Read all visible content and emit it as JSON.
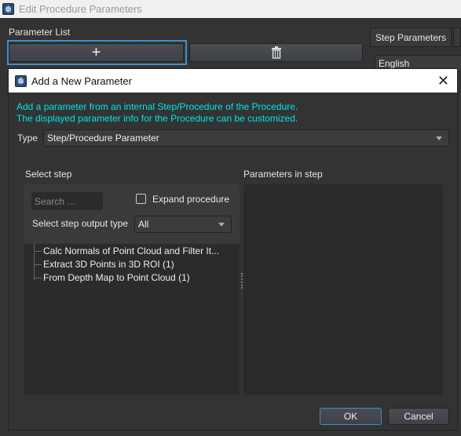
{
  "window": {
    "title": "Edit Procedure Parameters"
  },
  "main": {
    "parameter_list_label": "Parameter List",
    "add_icon": "+",
    "tabs": [
      {
        "label": "Step Parameters"
      }
    ],
    "language": "English"
  },
  "dialog": {
    "title": "Add a New Parameter",
    "info_lines": [
      "Add a parameter from an internal Step/Procedure of the Procedure.",
      "The displayed parameter info for the Procedure can be customized."
    ],
    "info_color": "#00e5e5",
    "type_label": "Type",
    "type_value": "Step/Procedure Parameter",
    "select_step_label": "Select step",
    "params_in_step_label": "Parameters in step",
    "search_placeholder": "Search ...",
    "expand_procedure_label": "Expand procedure",
    "expand_procedure_checked": false,
    "output_type_label": "Select step output type",
    "output_type_value": "All",
    "steps": [
      "Calc Normals of Point Cloud and Filter It...",
      "Extract 3D Points in 3D ROI (1)",
      "From Depth Map to Point Cloud (1)"
    ],
    "ok_label": "OK",
    "cancel_label": "Cancel"
  },
  "accent_color": "#3d8fd1"
}
